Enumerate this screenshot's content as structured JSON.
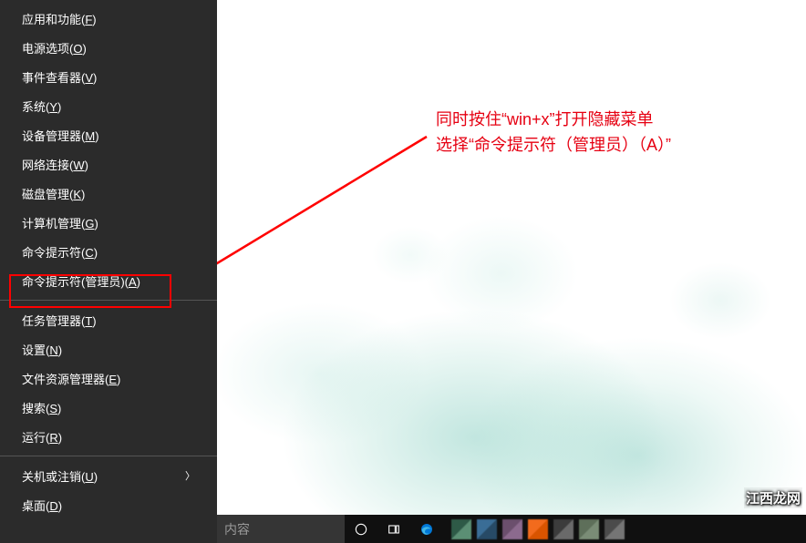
{
  "menu": {
    "items": [
      {
        "label": "应用和功能(F)",
        "hotkey": "F"
      },
      {
        "label": "电源选项(O)",
        "hotkey": "O"
      },
      {
        "label": "事件查看器(V)",
        "hotkey": "V"
      },
      {
        "label": "系统(Y)",
        "hotkey": "Y"
      },
      {
        "label": "设备管理器(M)",
        "hotkey": "M"
      },
      {
        "label": "网络连接(W)",
        "hotkey": "W"
      },
      {
        "label": "磁盘管理(K)",
        "hotkey": "K"
      },
      {
        "label": "计算机管理(G)",
        "hotkey": "G"
      },
      {
        "label": "命令提示符(C)",
        "hotkey": "C"
      },
      {
        "label": "命令提示符(管理员)(A)",
        "hotkey": "A"
      },
      {
        "label": "任务管理器(T)",
        "hotkey": "T"
      },
      {
        "label": "设置(N)",
        "hotkey": "N"
      },
      {
        "label": "文件资源管理器(E)",
        "hotkey": "E"
      },
      {
        "label": "搜索(S)",
        "hotkey": "S"
      },
      {
        "label": "运行(R)",
        "hotkey": "R"
      },
      {
        "label": "关机或注销(U)",
        "hotkey": "U",
        "submenu": true
      },
      {
        "label": "桌面(D)",
        "hotkey": "D"
      }
    ]
  },
  "annotation": {
    "line1": "同时按住“win+x”打开隐藏菜单",
    "line2": "选择“命令提示符（管理员）（A）”"
  },
  "taskbar": {
    "search_placeholder": "内容"
  },
  "watermark": "江西龙网",
  "colors": {
    "menu_bg": "#2b2b2b",
    "highlight": "#ff0000",
    "annotation": "#e60012",
    "taskbar_bg": "#101010"
  },
  "icons": {
    "cortana": "cortana-circle-icon",
    "taskview": "task-view-icon",
    "edge": "edge-icon"
  },
  "taskbar_tiles": [
    {
      "name": "app-tile-1",
      "color1": "#2e5a47",
      "color2": "#5b8f74"
    },
    {
      "name": "app-tile-2",
      "color1": "#3a6d96",
      "color2": "#274a66"
    },
    {
      "name": "app-tile-3",
      "color1": "#6b4f6d",
      "color2": "#8c6a8e"
    },
    {
      "name": "app-tile-4",
      "color1": "#f26b1d",
      "color2": "#d95400"
    },
    {
      "name": "app-tile-5",
      "color1": "#3c3c3c",
      "color2": "#6a6a6a"
    },
    {
      "name": "app-tile-6",
      "color1": "#5e6f5a",
      "color2": "#7a8c76"
    },
    {
      "name": "app-tile-7",
      "color1": "#4b4b4b",
      "color2": "#757575"
    }
  ]
}
